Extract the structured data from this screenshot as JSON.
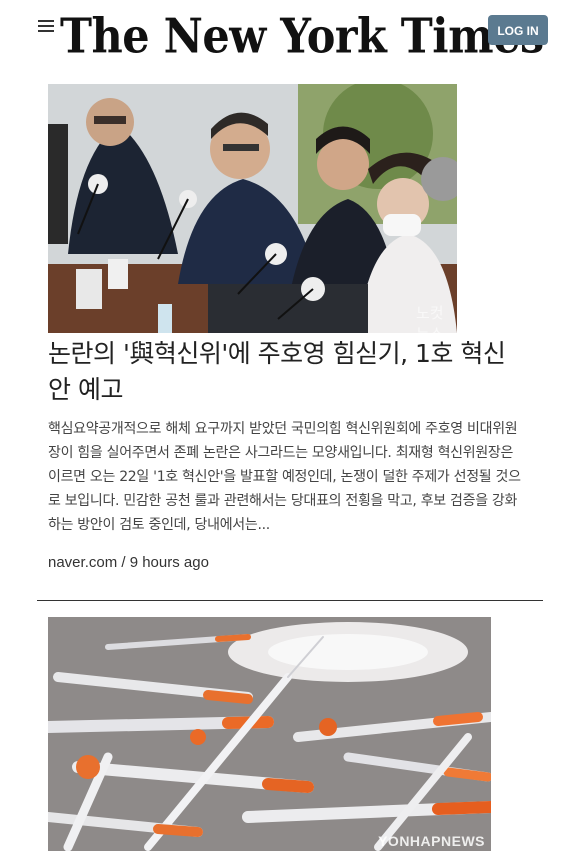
{
  "header": {
    "logo_text": "The New York Times",
    "login_label": "LOG IN"
  },
  "articles": [
    {
      "headline": "논란의 '與혁신위'에 주호영 힘싣기, 1호 혁신안 예고",
      "summary": "핵심요약공개적으로 해체 요구까지 받았던 국민의힘 혁신위원회에 주호영 비대위원장이 힘을 실어주면서 존폐 논란은 사그라드는 모양새입니다. 최재형 혁신위원장은 이르면 오는 22일 '1호 혁신안'을 발표할 예정인데, 논쟁이 덜한 주제가 선정될 것으로 보입니다. 민감한 공천 룰과 관련해서는 당대표의 전횡을 막고, 후보 검증을 강화하는 방안이 검토 중인데, 당내에서는...",
      "source": "naver.com / 9 hours ago",
      "image_watermark": "노컷뉴스"
    },
    {
      "image_watermark": "YONHAPNEWS"
    }
  ]
}
